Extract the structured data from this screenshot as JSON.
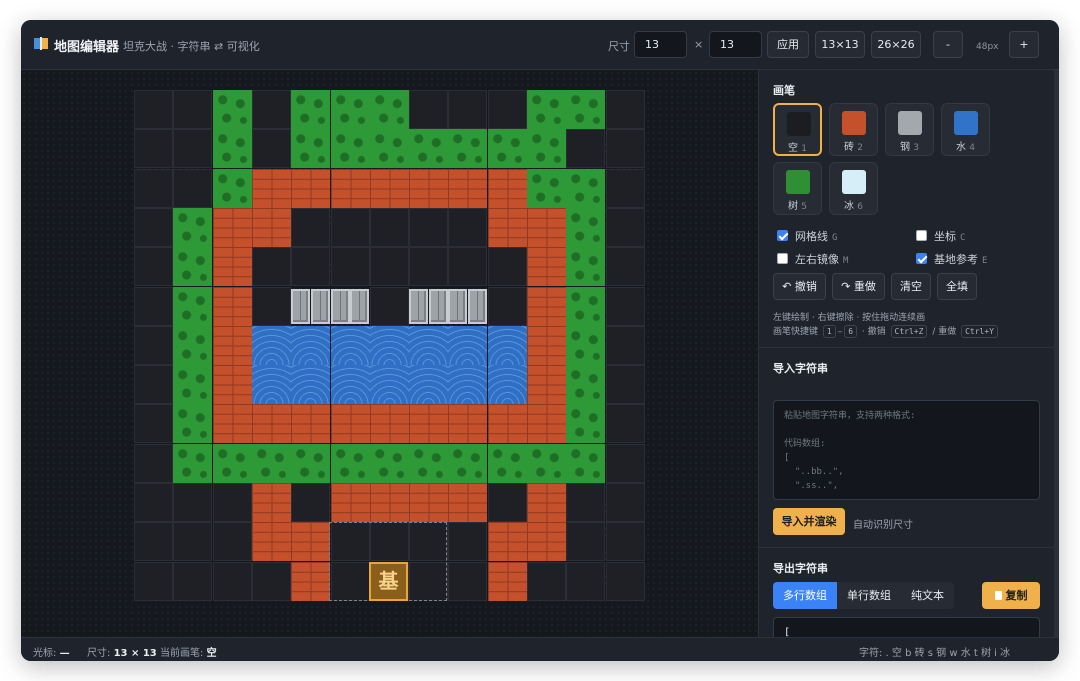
{
  "header": {
    "title": "地图编辑器",
    "subtitle": "坦克大战 · 字符串 ⇄ 可视化",
    "size_label": "尺寸",
    "width_value": "13",
    "times": "×",
    "height_value": "13",
    "apply_label": "应用",
    "preset_small": "13×13",
    "preset_large": "26×26",
    "zoom_out": "-",
    "zoom_value": "48px",
    "zoom_in": "+"
  },
  "map": {
    "rows": [
      "..t.ttt...tt.",
      "..t.ttttttt..",
      "..tbbbbbbbtt.",
      ".tbb.....bbt.",
      ".tb.......bt.",
      ".tb.ss.ss.bt.",
      ".tbwwwwwwwbt.",
      ".tbwwwwwwwbt.",
      ".tbbbbbbbbbt.",
      ".ttttttttttt.",
      "...b.bbbb.b..",
      "...bb....bb..",
      "....b....b..."
    ],
    "base_label": "基",
    "colors": {
      "brick": "#c4502c",
      "steel": "#9ea3a8",
      "water": "#2f6fc4",
      "tree": "#2e9a37",
      "empty": "#1e2025",
      "ice": "#d6eef7"
    }
  },
  "sidebar": {
    "brush_title": "画笔",
    "brushes": [
      {
        "name": "空",
        "num": "1",
        "color": "#1b1d21"
      },
      {
        "name": "砖",
        "num": "2",
        "color": "#c4502c"
      },
      {
        "name": "钢",
        "num": "3",
        "color": "#a3a8ad"
      },
      {
        "name": "水",
        "num": "4",
        "color": "#3073c8"
      },
      {
        "name": "树",
        "num": "5",
        "color": "#2e8f35"
      },
      {
        "name": "冰",
        "num": "6",
        "color": "#d6eef7"
      }
    ],
    "options": {
      "grid": "网格线",
      "grid_key": "G",
      "coords": "坐标",
      "coords_key": "C",
      "mirror": "左右镜像",
      "mirror_key": "M",
      "base_ref": "基地参考",
      "base_ref_key": "E"
    },
    "actions": {
      "undo": "↶ 撤销",
      "redo": "↷ 重做",
      "clear": "清空",
      "fill": "全填"
    },
    "hint_line1": "左键绘制 · 右键擦除 · 按住拖动连续画",
    "hint_prefix": "画笔快捷键",
    "hint_key1": "1",
    "hint_dash": "–",
    "hint_key6": "6",
    "hint_undo": "· 撤销",
    "hint_undo_key": "Ctrl+Z",
    "hint_redo": "/ 重做",
    "hint_redo_key": "Ctrl+Y",
    "import_title": "导入字符串",
    "import_placeholder": "粘贴地图字符串，支持两种格式:\n\n代码数组:\n[\n  \"..bb..\",\n  \".ss..\",",
    "import_button": "导入并渲染",
    "import_note": "自动识别尺寸",
    "export_title": "导出字符串",
    "export_tabs": [
      "多行数组",
      "单行数组",
      "纯文本"
    ],
    "copy_label": "复制",
    "export_output": "[\n  \"..t.ttt...tt.\","
  },
  "footer": {
    "cursor_label": "光标:",
    "cursor_value": "—",
    "size_label": "尺寸:",
    "size_value": "13 × 13",
    "brush_label": "当前画笔:",
    "brush_value": "空",
    "legend": "字符: . 空  b 砖  s 钢  w 水  t 树  i 冰"
  }
}
